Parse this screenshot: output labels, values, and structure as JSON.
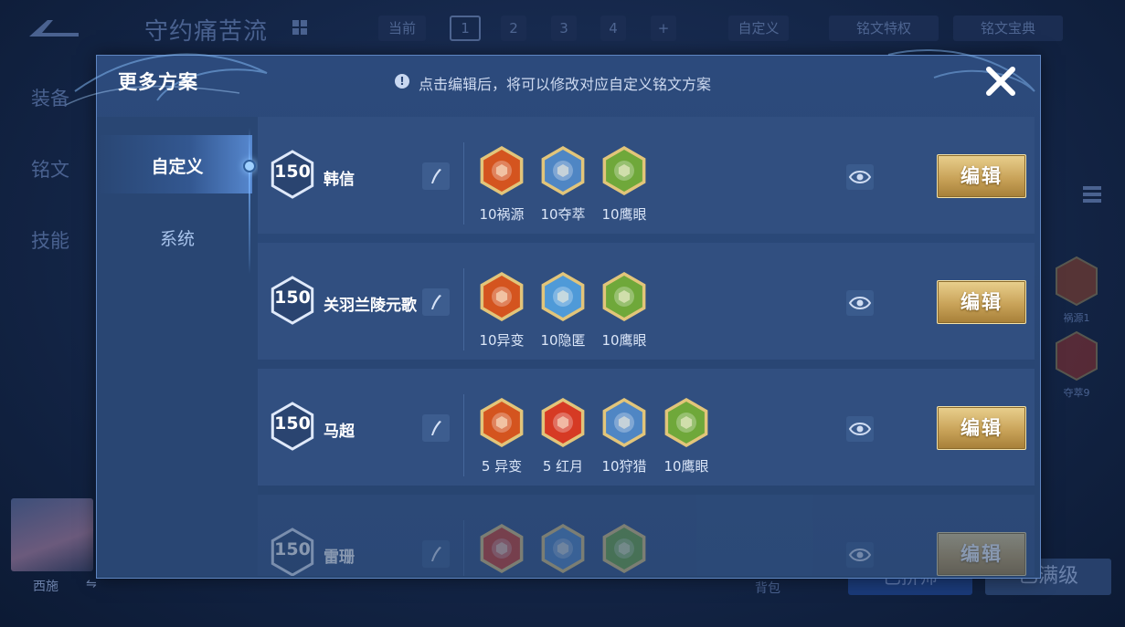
{
  "background": {
    "title": "守约痛苦流",
    "chips": [
      {
        "label": "当前",
        "selected": false
      },
      {
        "label": "1",
        "selected": true
      },
      {
        "label": "2",
        "selected": false
      },
      {
        "label": "3",
        "selected": false
      },
      {
        "label": "4",
        "selected": false
      },
      {
        "label": "+",
        "selected": false
      },
      {
        "label": "自定义",
        "selected": false
      },
      {
        "label": "铭文特权",
        "selected": false
      },
      {
        "label": "铭文宝典",
        "selected": false
      }
    ],
    "left_tabs": [
      "装备",
      "铭文",
      "技能"
    ],
    "right_runes": [
      "祸源1",
      "夺萃9"
    ],
    "avatar_name": "西施",
    "bag_label": "背包",
    "btn1_label": "已拼师",
    "btn2_label": "已满级"
  },
  "dialog": {
    "title": "更多方案",
    "hint": "点击编辑后，将可以修改对应自定义铭文方案",
    "sidebar": [
      {
        "label": "自定义",
        "active": true
      },
      {
        "label": "系统",
        "active": false
      }
    ],
    "edit_label": "编辑",
    "rows": [
      {
        "level": "150",
        "name": "韩信",
        "runes": [
          {
            "label": "10祸源",
            "icon": "disaster-rune-icon",
            "color": "#d4541f"
          },
          {
            "label": "10夺萃",
            "icon": "seize-rune-icon",
            "color": "#4f86c4"
          },
          {
            "label": "10鹰眼",
            "icon": "eagle-eye-rune-icon",
            "color": "#6fa83a"
          }
        ]
      },
      {
        "level": "150",
        "name": "关羽兰陵元歌",
        "runes": [
          {
            "label": "10异变",
            "icon": "mutation-rune-icon",
            "color": "#d4541f"
          },
          {
            "label": "10隐匿",
            "icon": "stealth-rune-icon",
            "color": "#4f9ad8"
          },
          {
            "label": "10鹰眼",
            "icon": "eagle-eye-rune-icon",
            "color": "#6fa83a"
          }
        ]
      },
      {
        "level": "150",
        "name": "马超",
        "runes": [
          {
            "label": "5 异变",
            "icon": "mutation-rune-icon",
            "color": "#d4541f"
          },
          {
            "label": "5 红月",
            "icon": "red-moon-rune-icon",
            "color": "#d63a24"
          },
          {
            "label": "10狩猎",
            "icon": "hunt-rune-icon",
            "color": "#4f86c4"
          },
          {
            "label": "10鹰眼",
            "icon": "eagle-eye-rune-icon",
            "color": "#6fa83a"
          }
        ]
      },
      {
        "level": "150",
        "name": "雷珊",
        "runes": [
          {
            "label": "",
            "icon": "red-moon-rune-icon",
            "color": "#d63a24"
          },
          {
            "label": "",
            "icon": "hunt-rune-icon",
            "color": "#4f86c4"
          },
          {
            "label": "",
            "icon": "eagle-eye-rune-icon",
            "color": "#6fa83a"
          }
        ]
      }
    ]
  }
}
